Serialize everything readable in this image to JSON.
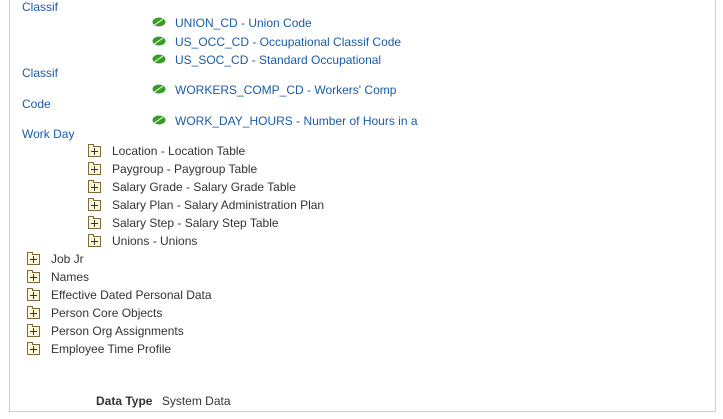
{
  "fields": [
    {
      "label": "UNION_CD - Union Code",
      "icon": "leaf-icon"
    },
    {
      "label": "US_OCC_CD - Occupational Classif Code",
      "icon": "leaf-icon"
    },
    {
      "label": "US_SOC_CD - Standard Occupational",
      "icon": "leaf-icon"
    },
    {
      "label": "WORKERS_COMP_CD - Workers' Comp",
      "icon": "leaf-icon"
    },
    {
      "label": "WORK_DAY_HOURS - Number of Hours in a",
      "icon": "leaf-icon"
    }
  ],
  "wrapped_text": [
    "Classif",
    "Classif",
    "Code",
    "Work Day"
  ],
  "sub_nodes": [
    {
      "label": "Location - Location Table"
    },
    {
      "label": "Paygroup - Paygroup Table"
    },
    {
      "label": "Salary Grade - Salary Grade Table"
    },
    {
      "label": "Salary Plan - Salary Administration Plan"
    },
    {
      "label": "Salary Step - Salary Step Table"
    },
    {
      "label": "Unions - Unions"
    }
  ],
  "top_nodes": [
    {
      "label": "Job Jr"
    },
    {
      "label": "Names"
    },
    {
      "label": "Effective Dated Personal Data"
    },
    {
      "label": "Person Core Objects"
    },
    {
      "label": "Person Org Assignments"
    },
    {
      "label": "Employee Time Profile"
    }
  ],
  "data_type": {
    "label": "Data Type",
    "value": "System Data"
  },
  "colors": {
    "link": "#1a5ca8",
    "text": "#333333",
    "leaf_icon": "#3a9a2a",
    "folder_border": "#7d6a3a"
  }
}
